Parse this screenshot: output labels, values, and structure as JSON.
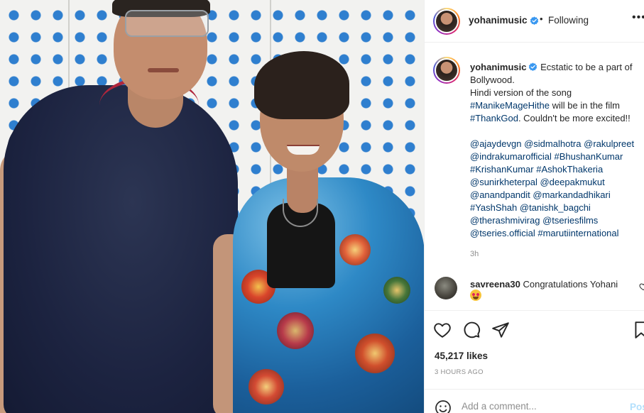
{
  "post": {
    "username": "yohanimusic",
    "follow_status": "Following",
    "more_label": "•••",
    "caption": {
      "lines": [
        "Ecstatic to be a part of",
        "Bollywood.",
        "Hindi version of the song",
        {
          "link": "#ManikeMageHithe",
          "text": " will be in the film"
        },
        {
          "link": "#ThankGod",
          "text": ". Couldn't be more excited!!"
        }
      ],
      "tags": [
        [
          "@ajaydevgn",
          "@sidmalhotra",
          "@rakulpreet"
        ],
        [
          "@indrakumarofficial",
          "#BhushanKumar"
        ],
        [
          "#KrishanKumar",
          "#AshokThakeria"
        ],
        [
          "@sunirkheterpal",
          "@deepakmukut"
        ],
        [
          "@anandpandit",
          "@markandadhikari"
        ],
        [
          "#YashShah",
          "@tanishk_bagchi"
        ],
        [
          "@therashmivirag",
          "@tseriesfilms"
        ],
        [
          "@tseries.official",
          "#marutiinternational"
        ]
      ]
    },
    "age": "3h",
    "comment": {
      "username": "savreena30",
      "text": "Congratulations Yohani",
      "emoji_icon": "heart-eyes-emoji"
    },
    "likes": "45,217 likes",
    "timestamp": "3 HOURS AGO",
    "add_comment": {
      "placeholder": "Add a comment...",
      "post_label": "Post"
    }
  },
  "colors": {
    "link": "#00376b",
    "verified": "#3897f0",
    "post_disabled": "#b2dffc",
    "meta": "#8e8e8e"
  },
  "icons": [
    "more-options-icon",
    "verified-badge-icon",
    "heart-icon",
    "comment-icon",
    "share-icon",
    "bookmark-icon",
    "emoji-icon"
  ]
}
